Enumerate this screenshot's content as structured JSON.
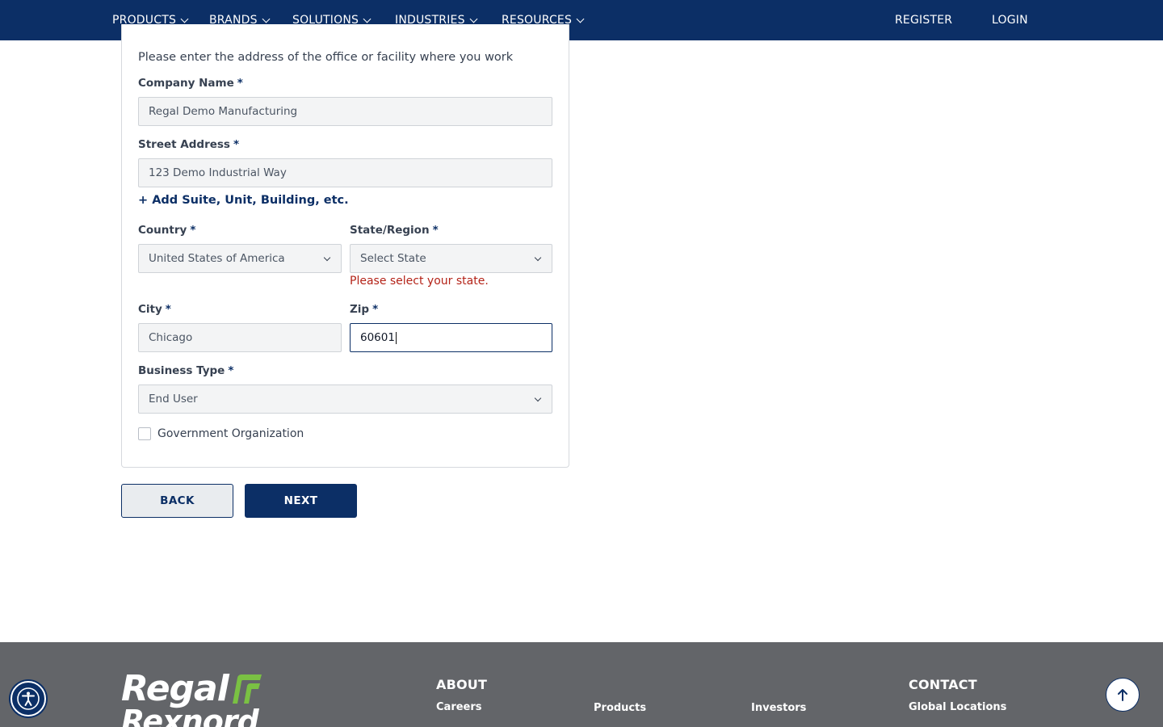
{
  "nav": {
    "items": [
      {
        "label": "PRODUCTS"
      },
      {
        "label": "BRANDS"
      },
      {
        "label": "SOLUTIONS"
      },
      {
        "label": "INDUSTRIES"
      },
      {
        "label": "RESOURCES"
      }
    ],
    "register": "REGISTER",
    "login": "LOGIN"
  },
  "form": {
    "intro": "Please enter the address of the office or facility where you work",
    "required_mark": "*",
    "company_name": {
      "label": "Company Name",
      "value": "Regal Demo Manufacturing"
    },
    "street_address": {
      "label": "Street Address",
      "value": "123 Demo Industrial Way"
    },
    "add_suite_link": "+ Add Suite, Unit, Building, etc.",
    "country": {
      "label": "Country",
      "value": "United States of America"
    },
    "state": {
      "label": "State/Region",
      "value": "Select State",
      "error": "Please select your state."
    },
    "city": {
      "label": "City",
      "value": "Chicago"
    },
    "zip": {
      "label": "Zip",
      "value": "60601"
    },
    "business_type": {
      "label": "Business Type",
      "value": "End User"
    },
    "government_checkbox": {
      "label": "Government Organization",
      "checked": false
    }
  },
  "buttons": {
    "back": "BACK",
    "next": "NEXT"
  },
  "footer": {
    "logo_line1": "Regal",
    "logo_line2": "Rexnord",
    "about_heading": "ABOUT",
    "careers": "Careers",
    "products": "Products",
    "investors": "Investors",
    "contact_heading": "CONTACT",
    "global_locations": "Global Locations"
  },
  "icons": {
    "accessibility": "accessibility-icon",
    "scroll_top": "arrow-up-icon"
  },
  "colors": {
    "brand_navy": "#0c2f66",
    "error_red": "#b42318",
    "footer_gray": "#636569",
    "logo_green": "#7ac143"
  }
}
